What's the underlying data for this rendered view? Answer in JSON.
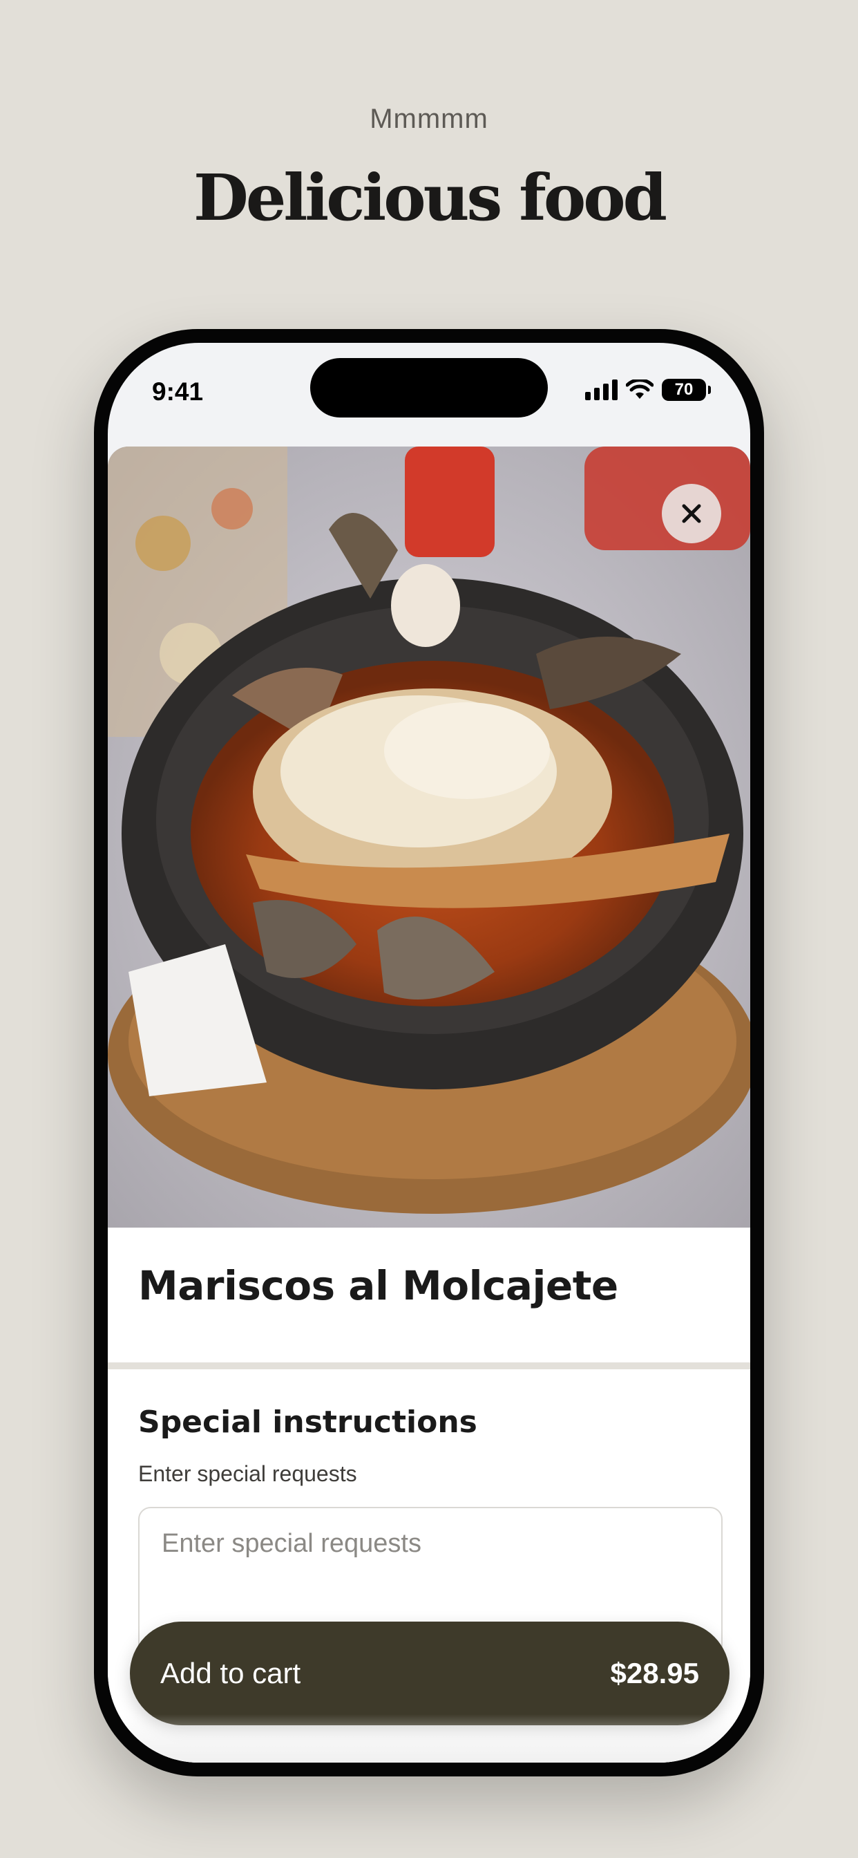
{
  "header": {
    "eyebrow": "Mmmmm",
    "title": "Delicious food"
  },
  "status_bar": {
    "time": "9:41",
    "battery": "70"
  },
  "item": {
    "name": "Mariscos al Molcajete"
  },
  "special_instructions": {
    "title": "Special instructions",
    "subtitle": "Enter special requests",
    "placeholder": "Enter special requests",
    "value": ""
  },
  "cart_button": {
    "label": "Add to cart",
    "price": "$28.95"
  },
  "colors": {
    "background": "#e2dfd8",
    "button": "#3e3a2a",
    "phone_frame": "#050505"
  }
}
